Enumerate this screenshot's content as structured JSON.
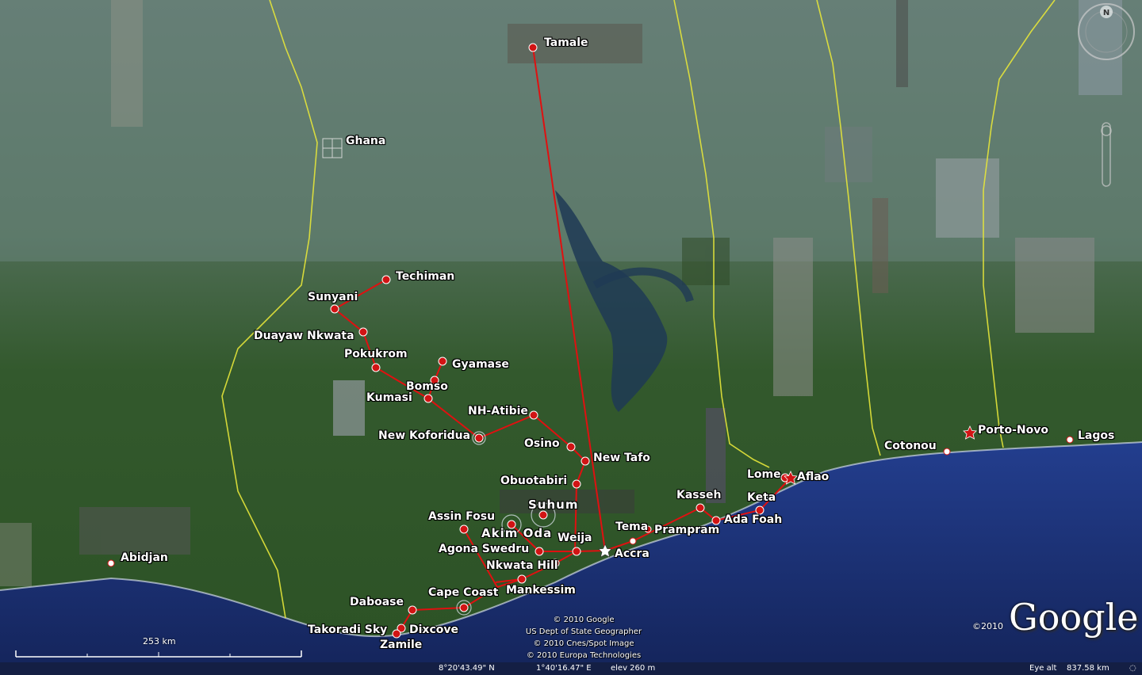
{
  "region": "Ghana",
  "colors": {
    "route": "#e01010",
    "marker": "#d11414",
    "border": "#e6e63a",
    "ocean": "#1a2f7a",
    "label": "#ffffff"
  },
  "places": [
    {
      "id": "tamale",
      "label": "Tamale",
      "marker": "dot"
    },
    {
      "id": "ghana",
      "label": "Ghana",
      "marker": "country-icon"
    },
    {
      "id": "techiman",
      "label": "Techiman",
      "marker": "dot"
    },
    {
      "id": "sunyani",
      "label": "Sunyani",
      "marker": "dot"
    },
    {
      "id": "duayaw-nkwata",
      "label": "Duayaw Nkwata",
      "marker": "dot"
    },
    {
      "id": "pokukrom",
      "label": "Pokukrom",
      "marker": "dot"
    },
    {
      "id": "gyamase",
      "label": "Gyamase",
      "marker": "dot"
    },
    {
      "id": "bomso",
      "label": "Bomso",
      "marker": "dot"
    },
    {
      "id": "kumasi",
      "label": "Kumasi",
      "marker": "dot"
    },
    {
      "id": "nh-atibie",
      "label": "NH-Atibie",
      "marker": "dot"
    },
    {
      "id": "new-koforidua",
      "label": "New Koforidua",
      "marker": "dot"
    },
    {
      "id": "osino",
      "label": "Osino",
      "marker": "dot"
    },
    {
      "id": "new-tafo",
      "label": "New Tafo",
      "marker": "dot"
    },
    {
      "id": "obuotabiri",
      "label": "Obuotabiri",
      "marker": "dot"
    },
    {
      "id": "suhum",
      "label": "Suhum",
      "marker": "dot"
    },
    {
      "id": "assin-fosu",
      "label": "Assin Fosu",
      "marker": "dot"
    },
    {
      "id": "akim-oda",
      "label": "Akim Oda",
      "marker": "dot"
    },
    {
      "id": "agona-swedru",
      "label": "Agona Swedru",
      "marker": "dot"
    },
    {
      "id": "weija",
      "label": "Weija",
      "marker": "dot"
    },
    {
      "id": "accra",
      "label": "Accra",
      "marker": "star"
    },
    {
      "id": "tema",
      "label": "Tema",
      "marker": "dot"
    },
    {
      "id": "prampram",
      "label": "Prampram",
      "marker": "dot"
    },
    {
      "id": "kasseh",
      "label": "Kasseh",
      "marker": "dot"
    },
    {
      "id": "ada-foah",
      "label": "Ada Foah",
      "marker": "dot"
    },
    {
      "id": "keta",
      "label": "Keta",
      "marker": "dot"
    },
    {
      "id": "lome",
      "label": "Lome",
      "marker": "dot"
    },
    {
      "id": "aflao",
      "label": "Aflao",
      "marker": "star"
    },
    {
      "id": "cotonou",
      "label": "Cotonou",
      "marker": "dot"
    },
    {
      "id": "porto-novo",
      "label": "Porto-Novo",
      "marker": "star"
    },
    {
      "id": "lagos",
      "label": "Lagos",
      "marker": "dot"
    },
    {
      "id": "abidjan",
      "label": "Abidjan",
      "marker": "dot"
    },
    {
      "id": "nkwata-hill",
      "label": "Nkwata Hill",
      "marker": "dot"
    },
    {
      "id": "mankessim",
      "label": "Mankessim",
      "marker": "dot"
    },
    {
      "id": "cape-coast",
      "label": "Cape Coast",
      "marker": "dot"
    },
    {
      "id": "daboase",
      "label": "Daboase",
      "marker": "dot"
    },
    {
      "id": "takoradi-sky",
      "label": "Takoradi Sky",
      "marker": "dot"
    },
    {
      "id": "dixcove",
      "label": "Dixcove",
      "marker": "dot"
    },
    {
      "id": "zamile",
      "label": "Zamile",
      "marker": "dot"
    }
  ],
  "credits": [
    "© 2010 Google",
    "US Dept of State Geographer",
    "© 2010 Cnes/Spot Image",
    "© 2010 Europa Technologies"
  ],
  "logo": {
    "text": "Google",
    "copyright": "©2010"
  },
  "scale": {
    "label": "253 km"
  },
  "status": {
    "lat": "8°20'43.49\" N",
    "lon": "1°40'16.47\" E",
    "elev": "elev  260 m",
    "eye_alt_label": "Eye alt",
    "eye_alt_value": "837.58 km"
  },
  "compass": {
    "north": "N"
  }
}
